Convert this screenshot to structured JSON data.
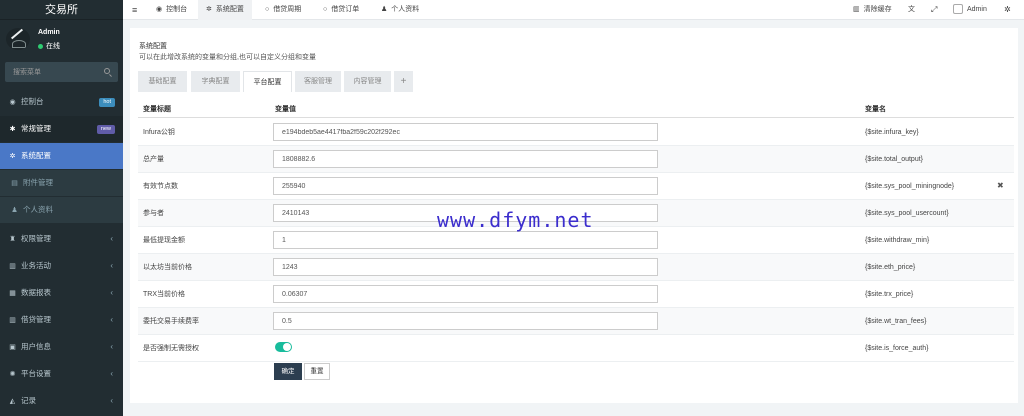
{
  "brand": "交易所",
  "user": {
    "name": "Admin",
    "status": "在线"
  },
  "search": {
    "placeholder": "搜索菜单"
  },
  "sidebar": [
    {
      "label": "控制台",
      "icon": "dashboard-icon",
      "glyph": "◉",
      "badge": "hot"
    },
    {
      "label": "常规管理",
      "icon": "cogs-icon",
      "glyph": "✱",
      "badge": "new"
    },
    {
      "label": "系统配置",
      "icon": "gear-icon",
      "glyph": "✲"
    },
    {
      "label": "附件管理",
      "icon": "file-icon",
      "glyph": "▤"
    },
    {
      "label": "个人资料",
      "icon": "user-icon",
      "glyph": "♟"
    },
    {
      "label": "权限管理",
      "icon": "group-icon",
      "glyph": "♜"
    },
    {
      "label": "业务活动",
      "icon": "list-icon",
      "glyph": "▥"
    },
    {
      "label": "数据报表",
      "icon": "chart-icon",
      "glyph": "▦"
    },
    {
      "label": "借贷管理",
      "icon": "list-icon",
      "glyph": "▥"
    },
    {
      "label": "用户信息",
      "icon": "id-card-icon",
      "glyph": "▣"
    },
    {
      "label": "平台设置",
      "icon": "settings-icon",
      "glyph": "✺"
    },
    {
      "label": "记录",
      "icon": "area-chart-icon",
      "glyph": "◭"
    }
  ],
  "topbar": {
    "menu_icon": "≡",
    "tabs": [
      {
        "label": "控制台",
        "icon": "dashboard-icon",
        "glyph": "◉"
      },
      {
        "label": "系统配置",
        "icon": "gear-icon",
        "glyph": "✲"
      },
      {
        "label": "借贷周期",
        "icon": "circle-icon",
        "glyph": "○"
      },
      {
        "label": "借贷订单",
        "icon": "circle-icon",
        "glyph": "○"
      },
      {
        "label": "个人资料",
        "icon": "user-icon",
        "glyph": "♟"
      }
    ],
    "clear_cache": "清除缓存",
    "translate_glyph": "文",
    "expand_glyph": "⤢",
    "admin": "Admin"
  },
  "panel": {
    "title": "系统配置",
    "description": "可以在此增改系统的变量和分组,也可以自定义分组和变量",
    "tabs": [
      "基础配置",
      "字典配置",
      "平台配置",
      "客服管理",
      "内容管理",
      "+"
    ],
    "active_tab": 2
  },
  "table": {
    "headers": [
      "变量标题",
      "变量值",
      "变量名"
    ],
    "rows": [
      {
        "title": "Infura公钥",
        "value": "e194bdeb5ae4417fba2f59c202f292ec",
        "name": "{$site.infura_key}"
      },
      {
        "title": "总产量",
        "value": "1808882.6",
        "name": "{$site.total_output}"
      },
      {
        "title": "有效节点数",
        "value": "255940",
        "name": "{$site.sys_pool_miningnode}",
        "delete": "✖"
      },
      {
        "title": "参与者",
        "value": "2410143",
        "name": "{$site.sys_pool_usercount}"
      },
      {
        "title": "最低提现金额",
        "value": "1",
        "name": "{$site.withdraw_min}"
      },
      {
        "title": "以太坊当前价格",
        "value": "1243",
        "name": "{$site.eth_price}"
      },
      {
        "title": "TRX当前价格",
        "value": "0.06307",
        "name": "{$site.trx_price}"
      },
      {
        "title": "委托交易手续费率",
        "value": "0.5",
        "name": "{$site.wt_tran_fees}"
      },
      {
        "title": "是否强制无需授权",
        "toggle": true,
        "name": "{$site.is_force_auth}"
      }
    ]
  },
  "buttons": {
    "submit": "确定",
    "reset": "重置"
  },
  "watermark": "www.dfym.net"
}
